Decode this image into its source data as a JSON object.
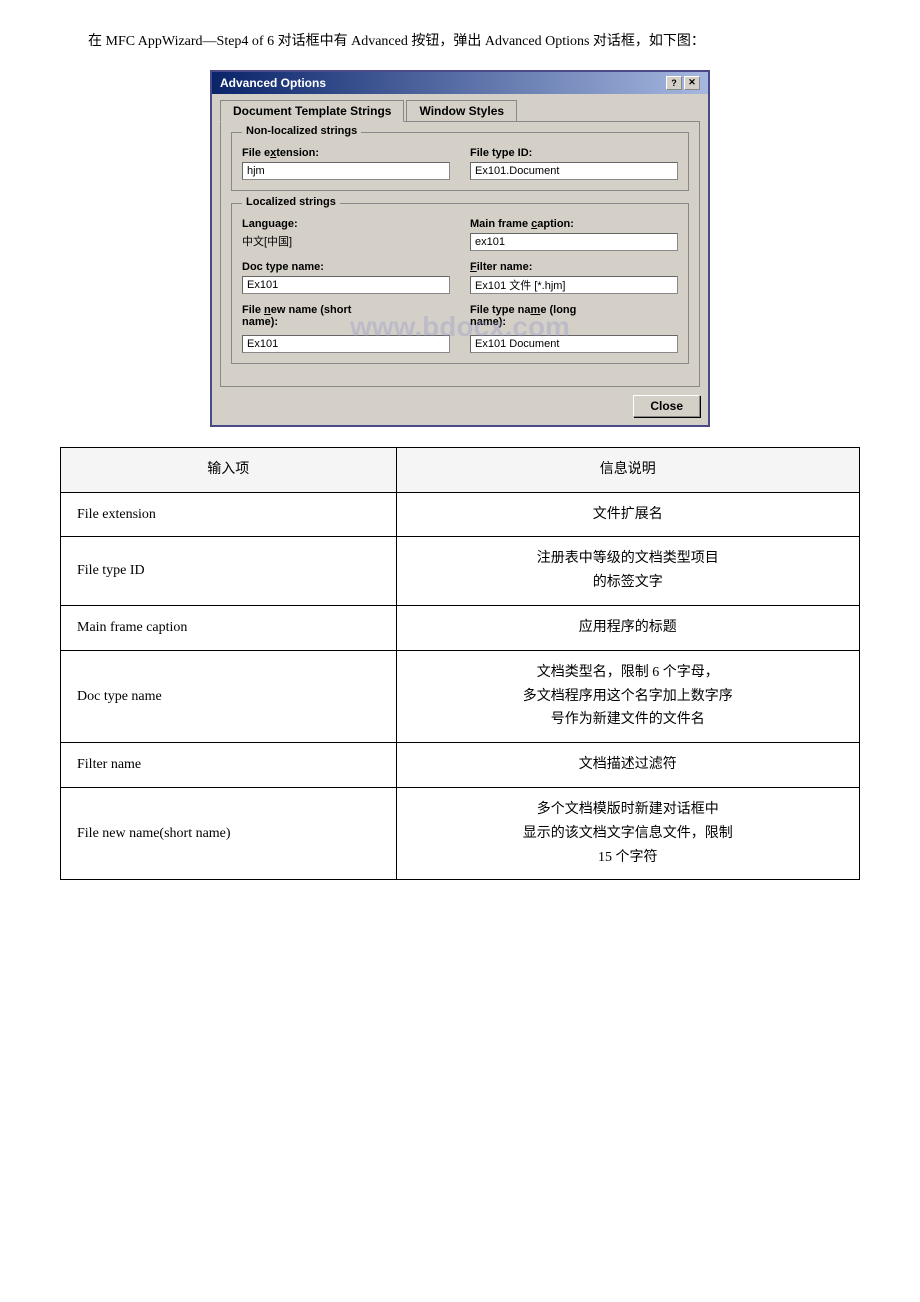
{
  "intro": {
    "text": "在 MFC AppWizard—Step4 of 6 对话框中有 Advanced 按钮，弹出 Advanced Options 对话框，如下图："
  },
  "dialog": {
    "title": "Advanced Options",
    "tabs": [
      {
        "label": "Document Template Strings",
        "active": true
      },
      {
        "label": "Window Styles",
        "active": false
      }
    ],
    "non_localized": {
      "group_title": "Non-localized strings",
      "file_extension_label": "File extension:",
      "file_extension_value": "hjm",
      "file_type_id_label": "File type ID:",
      "file_type_id_value": "Ex101.Document"
    },
    "localized": {
      "group_title": "Localized strings",
      "language_label": "Language:",
      "language_value": "中文[中国]",
      "main_frame_label": "Main frame caption:",
      "main_frame_value": "ex101",
      "doc_type_label": "Doc type name:",
      "doc_type_value": "Ex101",
      "filter_name_label": "Filter name:",
      "filter_name_value": "Ex101 文件 [*.hjm]",
      "file_new_short_label": "File new name (short name):",
      "file_new_short_value": "Ex101",
      "file_type_long_label": "File type name (long name):",
      "file_type_long_value": "Ex101 Document"
    },
    "close_button": "Close",
    "watermark": "www.bdocx.com"
  },
  "table": {
    "header": [
      "输入项",
      "信息说明"
    ],
    "rows": [
      {
        "input": "File extension",
        "description": "文件扩展名"
      },
      {
        "input": "File type ID",
        "description": "注册表中等级的文档类型项目\n的标签文字"
      },
      {
        "input": "Main frame caption",
        "description": "应用程序的标题"
      },
      {
        "input": "Doc type name",
        "description": "文档类型名，限制 6 个字母，\n多文档程序用这个名字加上数字序\n号作为新建文件的文件名"
      },
      {
        "input": "Filter name",
        "description": "文档描述过滤符"
      },
      {
        "input": "File new name(short name)",
        "description": "多个文档模版时新建对话框中\n显示的该文档文字信息文件，限制\n15 个字符"
      }
    ]
  }
}
